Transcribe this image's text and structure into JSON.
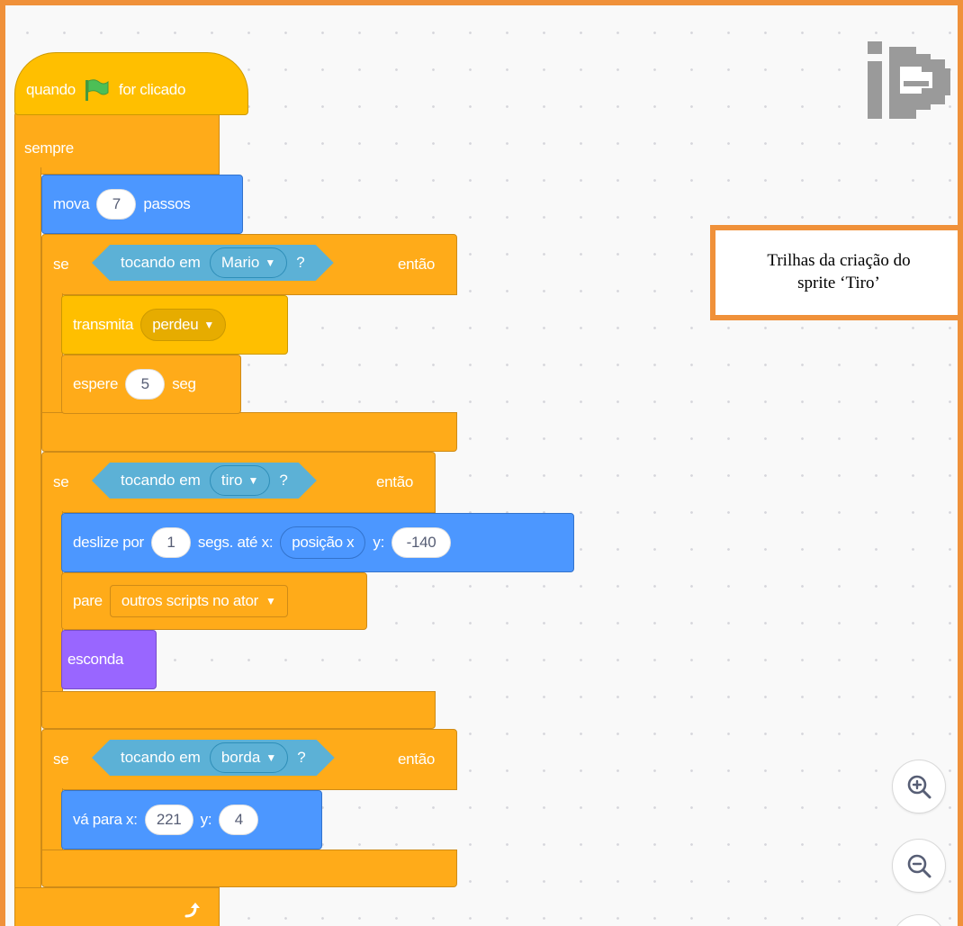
{
  "script": {
    "when_prefix": "quando",
    "when_suffix": "for clicado",
    "forever": "sempre",
    "move_prefix": "mova",
    "move_steps": "7",
    "move_suffix": "passos",
    "if_label": "se",
    "then_label": "então",
    "touching_label": "tocando em",
    "question": "?",
    "if1_target": "Mario",
    "broadcast_label": "transmita",
    "broadcast_message": "perdeu",
    "wait_label": "espere",
    "wait_value": "5",
    "wait_unit": "seg",
    "if2_target": "tiro",
    "glide_prefix": "deslize por",
    "glide_secs": "1",
    "glide_middle": "segs. até x:",
    "glide_x_reporter": "posição x",
    "glide_y_label": "y:",
    "glide_y": "-140",
    "stop_label": "pare",
    "stop_option": "outros scripts no ator",
    "hide_label": "esconda",
    "if3_target": "borda",
    "goto_prefix": "vá para x:",
    "goto_x": "221",
    "goto_y_label": "y:",
    "goto_y": "4"
  },
  "callout": {
    "line1": "Trilhas da criação do",
    "line2": "sprite ‘Tiro’"
  },
  "colors": {
    "control": "#FFAB19",
    "events": "#FFBF00",
    "motion": "#4C97FF",
    "looks": "#9966FF",
    "sensing": "#5CB1D6",
    "border": "#F0913A",
    "flag": "#4CBF56"
  },
  "icons": [
    "green-flag-icon",
    "dropdown-arrow-icon",
    "loop-arrow-icon",
    "sprite-thumbnail-icon",
    "zoom-in-icon",
    "zoom-out-icon"
  ]
}
